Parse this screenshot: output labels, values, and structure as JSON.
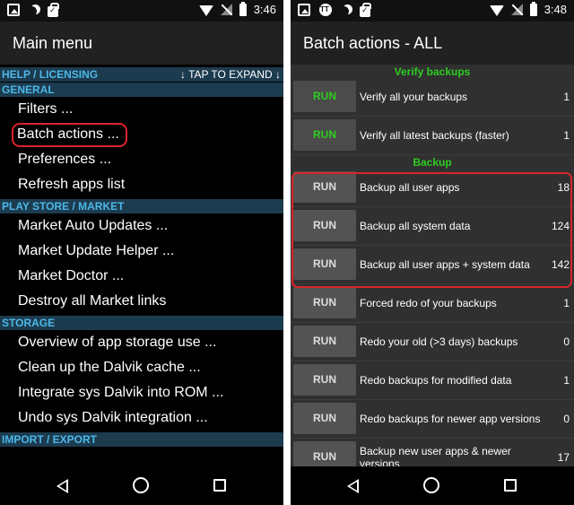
{
  "left": {
    "status": {
      "time": "3:46"
    },
    "app_bar": {
      "title": "Main menu"
    },
    "sections": [
      {
        "header": "HELP / LICENSING",
        "hint": "↓ TAP TO EXPAND ↓",
        "items": []
      },
      {
        "header": "GENERAL",
        "items": [
          "Filters ...",
          "Batch actions ...",
          "Preferences ...",
          "Refresh apps list"
        ]
      },
      {
        "header": "PLAY STORE / MARKET",
        "items": [
          "Market Auto Updates ...",
          "Market Update Helper ...",
          "Market Doctor ...",
          "Destroy all Market links"
        ]
      },
      {
        "header": "STORAGE",
        "items": [
          "Overview of app storage use ...",
          "Clean up the Dalvik cache ...",
          "Integrate sys Dalvik into ROM ...",
          "Undo sys Dalvik integration ..."
        ]
      },
      {
        "header": "IMPORT / EXPORT",
        "items": []
      }
    ]
  },
  "right": {
    "status": {
      "time": "3:48"
    },
    "app_bar": {
      "title": "Batch actions - ALL"
    },
    "verify_header": "Verify backups",
    "backup_header": "Backup",
    "run_label": "RUN",
    "verify_rows": [
      {
        "label": "Verify all your backups",
        "count": "1"
      },
      {
        "label": "Verify all latest backups (faster)",
        "count": "1"
      }
    ],
    "backup_rows": [
      {
        "label": "Backup all user apps",
        "count": "18"
      },
      {
        "label": "Backup all system data",
        "count": "124"
      },
      {
        "label": "Backup all user apps + system data",
        "count": "142"
      },
      {
        "label": "Forced redo of your backups",
        "count": "1"
      },
      {
        "label": "Redo your old (>3 days) backups",
        "count": "0"
      },
      {
        "label": "Redo backups for modified data",
        "count": "1"
      },
      {
        "label": "Redo backups for newer app versions",
        "count": "0"
      },
      {
        "label": "Backup new user apps & newer versions",
        "count": "17"
      }
    ]
  },
  "colors": {
    "accent_green": "#2ecc21",
    "section_blue": "#4bb8e8",
    "highlight_red": "#d9252b"
  }
}
